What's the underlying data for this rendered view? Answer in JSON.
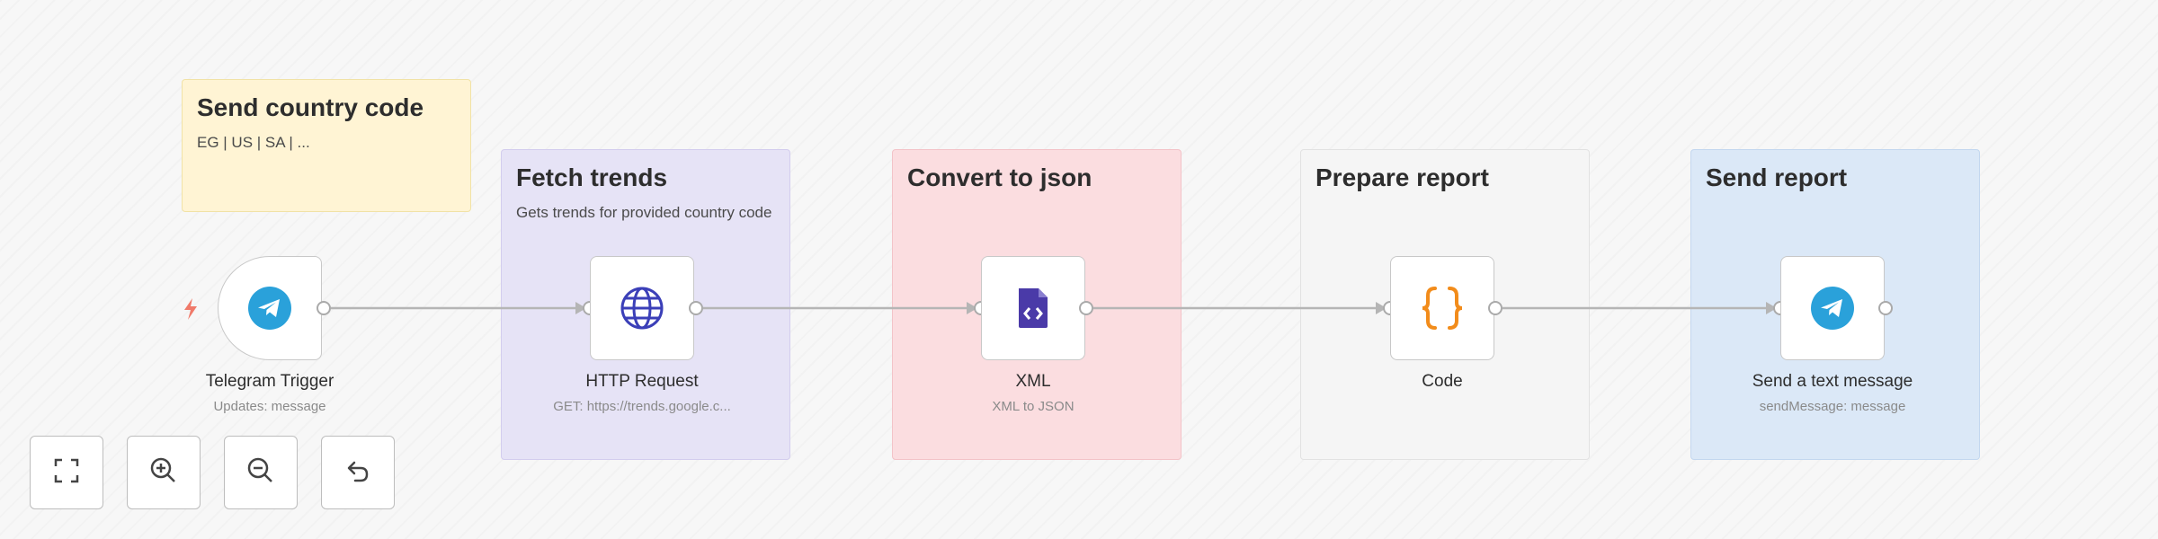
{
  "sticky_notes": [
    {
      "title": "Send country code",
      "subtitle": "EG | US | SA | ...",
      "color": "#fff4d4"
    },
    {
      "title": "Fetch trends",
      "subtitle": "Gets trends for provided country code",
      "color": "#e6e3f6"
    },
    {
      "title": "Convert to json",
      "subtitle": "",
      "color": "#fbdde0"
    },
    {
      "title": "Prepare report",
      "subtitle": "",
      "color": "#f5f5f5"
    },
    {
      "title": "Send report",
      "subtitle": "",
      "color": "#dbe8f7"
    }
  ],
  "nodes": [
    {
      "label": "Telegram Trigger",
      "subtitle": "Updates: message",
      "icon": "telegram-icon"
    },
    {
      "label": "HTTP Request",
      "subtitle": "GET: https://trends.google.c...",
      "icon": "globe-icon"
    },
    {
      "label": "XML",
      "subtitle": "XML to JSON",
      "icon": "xml-file-icon"
    },
    {
      "label": "Code",
      "subtitle": "",
      "icon": "code-braces-icon"
    },
    {
      "label": "Send a text message",
      "subtitle": "sendMessage: message",
      "icon": "telegram-icon"
    }
  ],
  "controls": [
    {
      "name": "fit-view-button",
      "icon": "fullscreen-icon"
    },
    {
      "name": "zoom-in-button",
      "icon": "zoom-in-icon"
    },
    {
      "name": "zoom-out-button",
      "icon": "zoom-out-icon"
    },
    {
      "name": "reset-zoom-button",
      "icon": "undo-icon"
    }
  ],
  "colors": {
    "telegram": "#2aa1da",
    "http": "#3b3fb8",
    "xml": "#4a3aa8",
    "code": "#f28c1b",
    "trigger_bolt": "#f07a6a",
    "connection": "#b5b5b5"
  }
}
